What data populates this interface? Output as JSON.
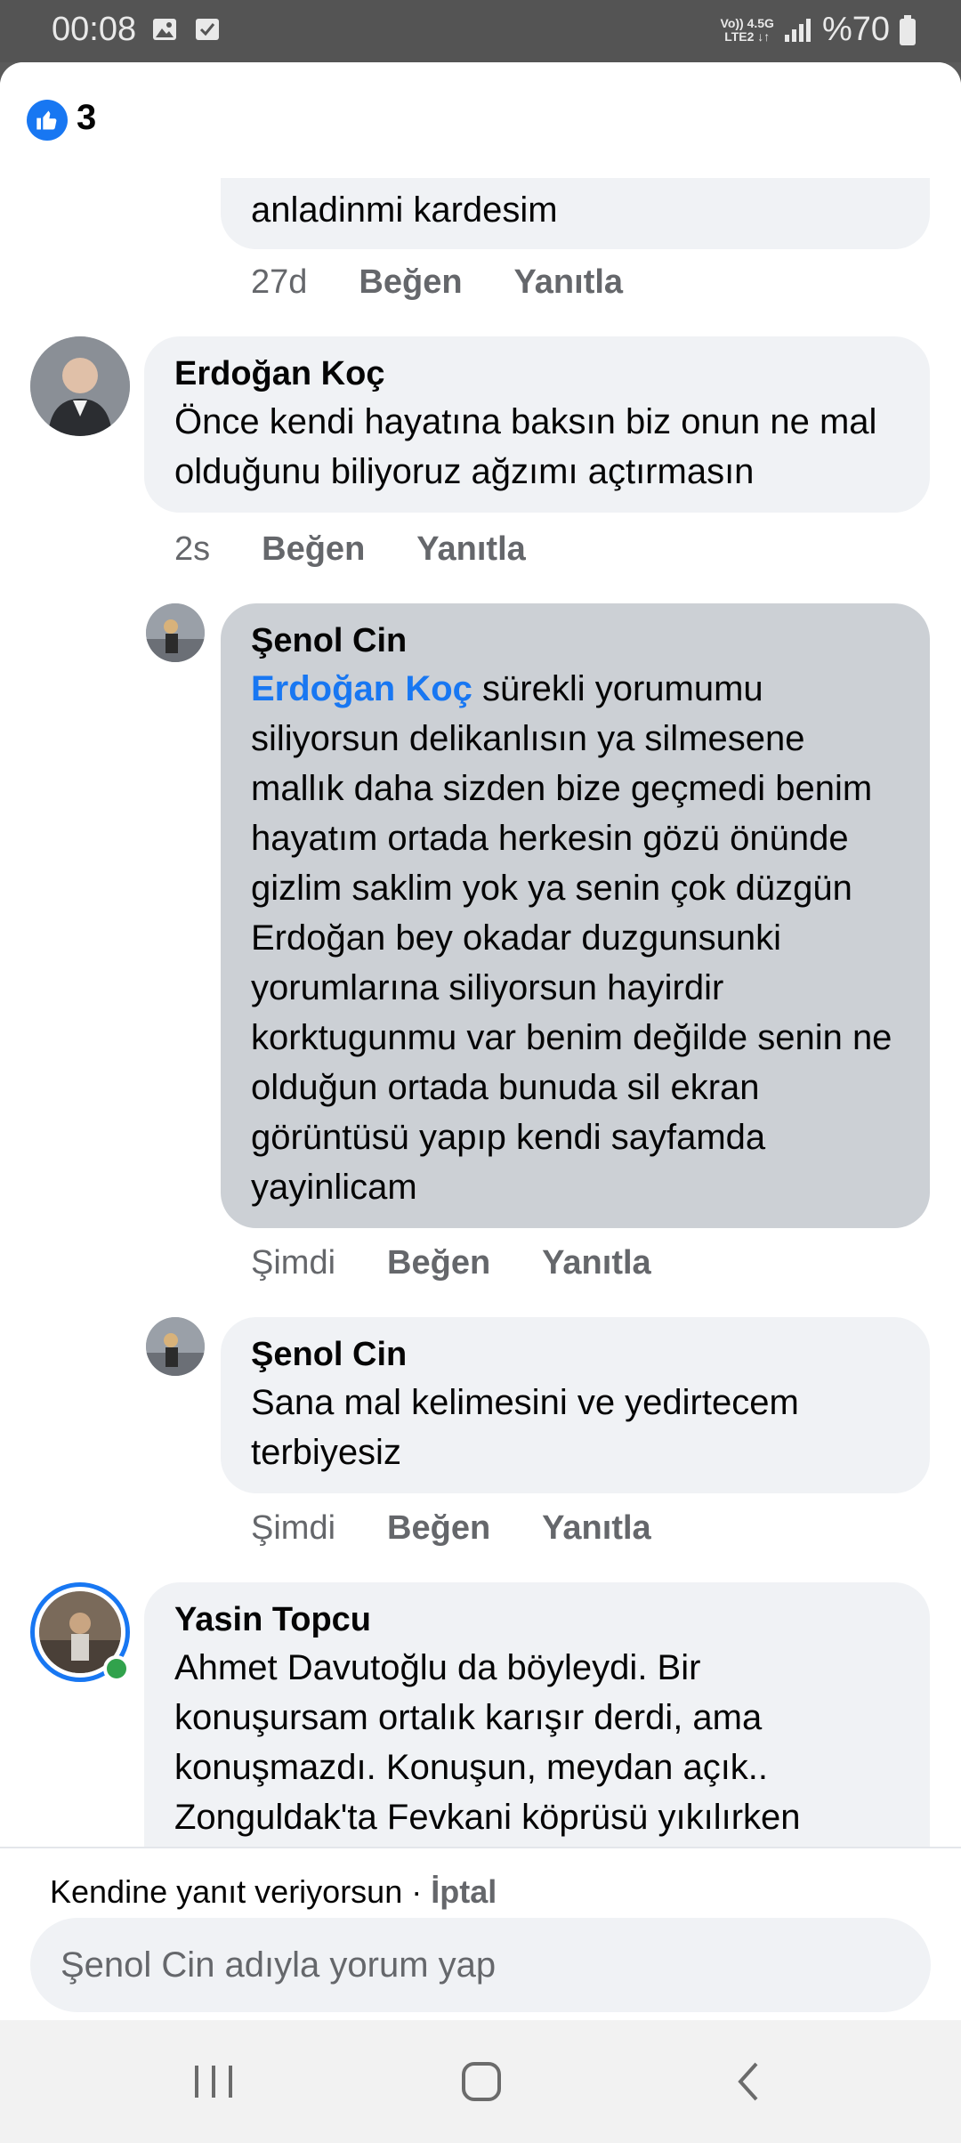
{
  "status": {
    "time": "00:08",
    "network_line1": "Vo)) 4.5G",
    "network_line2": "LTE2 ↓↑",
    "battery": "%70"
  },
  "header": {
    "like_count": "3",
    "like_icon": "thumbs-up-icon"
  },
  "comments": [
    {
      "text": "anladinmi kardesim",
      "time": "27d",
      "like": "Beğen",
      "reply": "Yanıtla"
    },
    {
      "author": "Erdoğan Koç",
      "text": "Önce kendi hayatına baksın biz onun ne mal olduğunu biliyoruz ağzımı açtırmasın",
      "time": "2s",
      "like": "Beğen",
      "reply": "Yanıtla"
    },
    {
      "author": "Şenol Cin",
      "mention": "Erdoğan Koç",
      "text": " sürekli yorumumu siliyorsun delikanlısın ya silmesene mallık daha sizden bize geçmedi benim hayatım ortada herkesin gözü önünde gizlim saklim yok ya senin çok düzgün  Erdoğan bey okadar duzgunsunki yorumlarına siliyorsun hayirdir korktugunmu var benim değilde senin ne olduğun ortada bunuda sil ekran görüntüsü yapıp kendi sayfamda yayinlicam",
      "time": "Şimdi",
      "like": "Beğen",
      "reply": "Yanıtla"
    },
    {
      "author": "Şenol Cin",
      "text": "Sana mal kelimesini ve yedirtecem terbiyesiz",
      "time": "Şimdi",
      "like": "Beğen",
      "reply": "Yanıtla"
    },
    {
      "author": "Yasin Topcu",
      "text": "Ahmet Davutoğlu da böyleydi. Bir konuşursam ortalık karışır derdi, ama konuşmazdı. Konuşun, meydan açık.. Zonguldak'ta Fevkani köprüsü yıkılırken"
    }
  ],
  "composer": {
    "reply_note": "Kendine yanıt veriyorsun · ",
    "cancel": "İptal",
    "placeholder": "Şenol Cin adıyla yorum yap"
  },
  "colors": {
    "accent": "#1877f2",
    "bubble": "#f0f2f5",
    "selected_bubble": "#ccd0d5",
    "meta": "#65676b",
    "online": "#31a24c"
  }
}
